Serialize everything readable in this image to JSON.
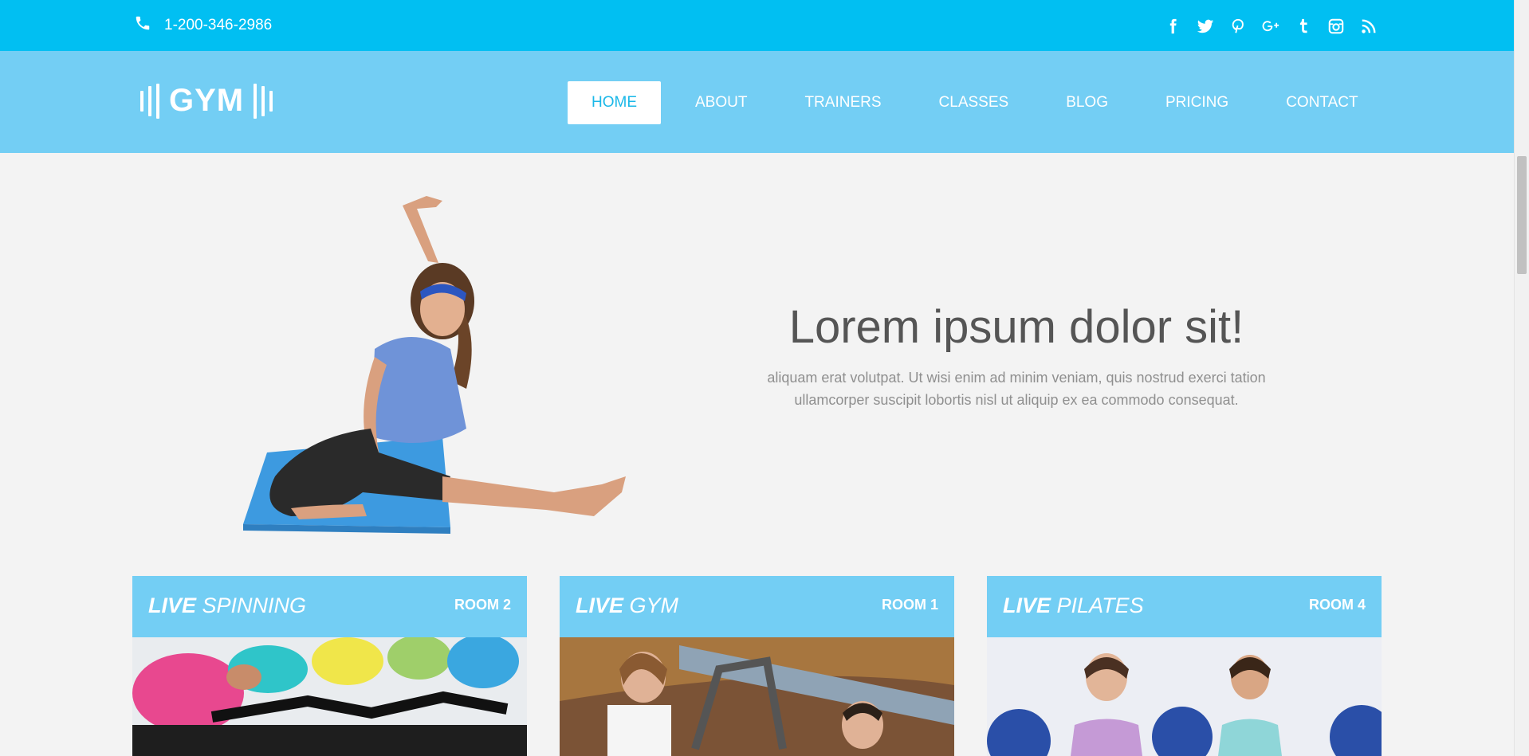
{
  "topbar": {
    "phone": "1-200-346-2986",
    "social_icons": [
      "facebook-icon",
      "twitter-icon",
      "pinterest-icon",
      "google-plus-icon",
      "tumblr-icon",
      "instagram-icon",
      "rss-icon"
    ]
  },
  "header": {
    "logo_text": "GYM",
    "nav": [
      {
        "label": "HOME",
        "active": true
      },
      {
        "label": "ABOUT"
      },
      {
        "label": "TRAINERS"
      },
      {
        "label": "CLASSES"
      },
      {
        "label": "BLOG"
      },
      {
        "label": "PRICING"
      },
      {
        "label": "CONTACT"
      }
    ]
  },
  "hero": {
    "title": "Lorem ipsum dolor sit!",
    "line1": "aliquam erat volutpat. Ut wisi enim ad minim veniam, quis nostrud exerci tation",
    "line2": "ullamcorper suscipit lobortis nisl ut aliquip ex ea commodo consequat."
  },
  "cards": [
    {
      "live": "LIVE",
      "name": "SPINNING",
      "room": "ROOM 2"
    },
    {
      "live": "LIVE",
      "name": "GYM",
      "room": "ROOM 1"
    },
    {
      "live": "LIVE",
      "name": "PILATES",
      "room": "ROOM 4"
    }
  ],
  "colors": {
    "topbar": "#01bff2",
    "navbar": "#73cef4",
    "active_text": "#1bb8e8",
    "page_bg": "#f3f3f3"
  }
}
